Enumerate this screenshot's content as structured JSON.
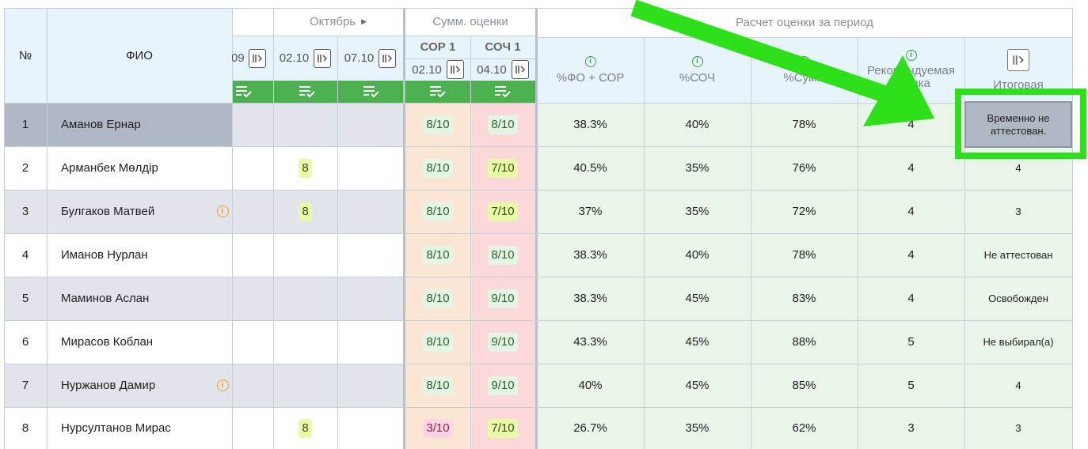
{
  "header": {
    "num": "№",
    "fio": "ФИО",
    "month": "Октябрь",
    "sum_group": "Сумм. оценки",
    "calc_group": "Расчет оценки за период",
    "date_partial": "09",
    "date1": "02.10",
    "date2": "07.10",
    "sor_label": "СОР 1",
    "sor_date": "02.10",
    "soch_label": "СОЧ 1",
    "soch_date": "04.10",
    "pct_fo_sor": "%ФО + СОР",
    "pct_soch": "%СОЧ",
    "pct_sum": "%Сумм",
    "recommended_l1": "Рекомендуемая",
    "recommended_l2": "оценка",
    "final": "Итоговая"
  },
  "rows": [
    {
      "num": "1",
      "name": "Аманов Ернар",
      "oct": "",
      "sor": "8/10",
      "soch": "8/10",
      "fo_sor": "38.3%",
      "soch_pct": "40%",
      "sum_pct": "78%",
      "rec": "4",
      "final": "Временно не аттестован.",
      "info": false,
      "selected": true
    },
    {
      "num": "2",
      "name": "Арманбек Мөлдір",
      "oct": "8",
      "sor": "8/10",
      "soch": "7/10",
      "fo_sor": "40.5%",
      "soch_pct": "35%",
      "sum_pct": "76%",
      "rec": "4",
      "final": "4",
      "info": false
    },
    {
      "num": "3",
      "name": "Булгаков Матвей",
      "oct": "8",
      "sor": "8/10",
      "soch": "7/10",
      "fo_sor": "37%",
      "soch_pct": "35%",
      "sum_pct": "72%",
      "rec": "4",
      "final": "3",
      "info": true
    },
    {
      "num": "4",
      "name": "Иманов Нурлан",
      "oct": "",
      "sor": "8/10",
      "soch": "8/10",
      "fo_sor": "38.3%",
      "soch_pct": "40%",
      "sum_pct": "78%",
      "rec": "4",
      "final": "Не аттестован",
      "info": false
    },
    {
      "num": "5",
      "name": "Маминов Аслан",
      "oct": "",
      "sor": "8/10",
      "soch": "9/10",
      "fo_sor": "38.3%",
      "soch_pct": "45%",
      "sum_pct": "83%",
      "rec": "4",
      "final": "Освобожден",
      "info": false
    },
    {
      "num": "6",
      "name": "Мирасов Коблан",
      "oct": "",
      "sor": "8/10",
      "soch": "9/10",
      "fo_sor": "43.3%",
      "soch_pct": "45%",
      "sum_pct": "88%",
      "rec": "5",
      "final": "Не выбирал(а)",
      "info": false
    },
    {
      "num": "7",
      "name": "Нуржанов Дамир",
      "oct": "",
      "sor": "8/10",
      "soch": "9/10",
      "fo_sor": "40%",
      "soch_pct": "45%",
      "sum_pct": "85%",
      "rec": "5",
      "final": "4",
      "info": true
    },
    {
      "num": "8",
      "name": "Нурсултанов Мирас",
      "oct": "8",
      "sor": "3/10",
      "soch": "7/10",
      "fo_sor": "26.7%",
      "soch_pct": "35%",
      "sum_pct": "62%",
      "rec": "3",
      "final": "3",
      "info": false
    }
  ],
  "colors": {
    "green_bar": "#4caf50",
    "sor_col": "#fbe6d4",
    "soch_col": "#fbd9d9",
    "calc_row": "#e8f5e8",
    "gray_row": "#e1e4ea",
    "highlight": "#2ee01a"
  }
}
